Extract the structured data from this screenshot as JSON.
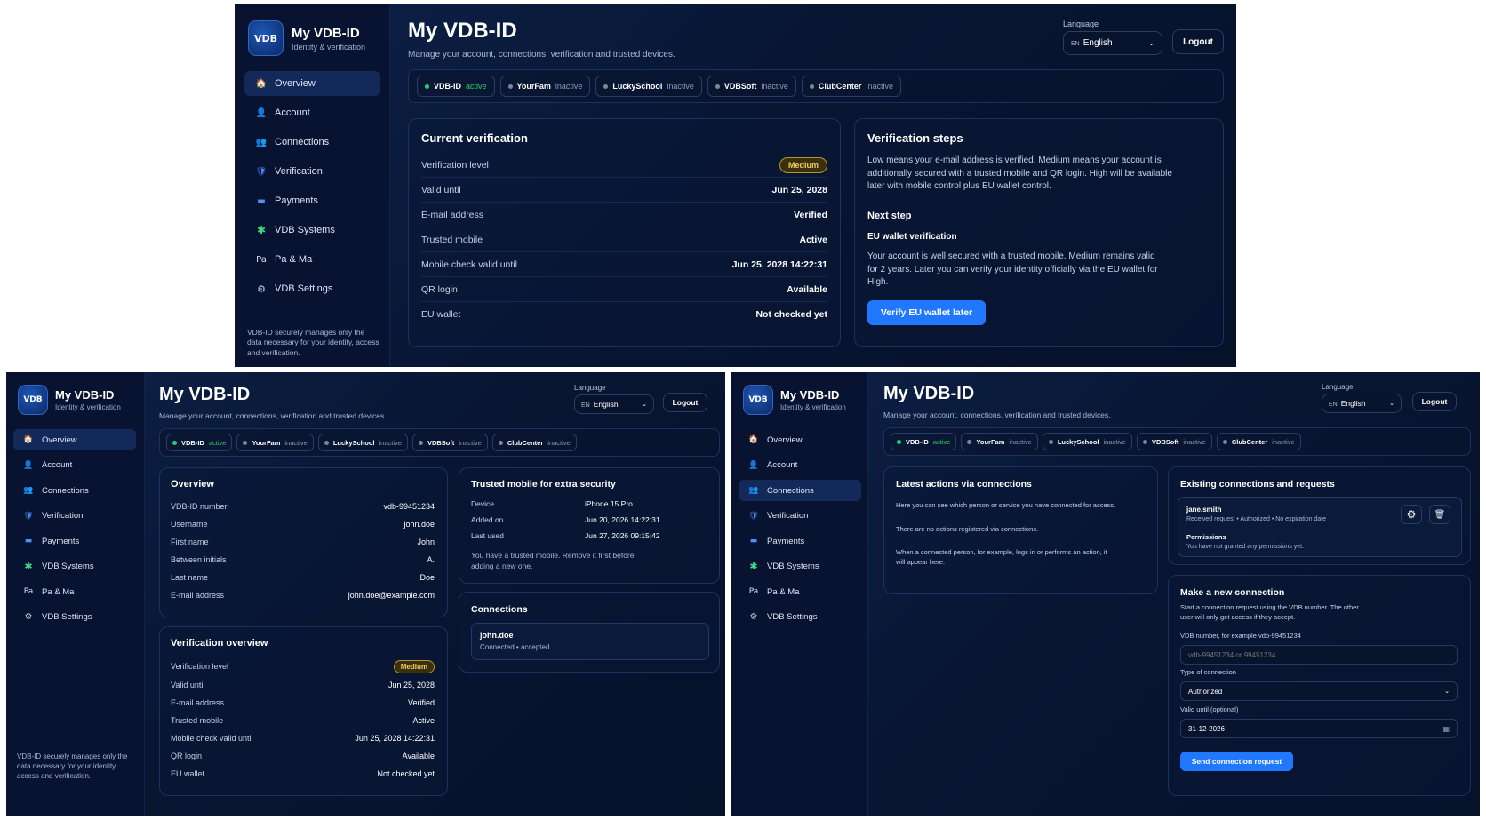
{
  "app": {
    "title": "My VDB-ID",
    "brand": "My VDB-ID",
    "brand_sub": "Identity & verification",
    "logo_text": "VDB",
    "subtitle": "Manage your account, connections, verification and trusted devices."
  },
  "lang": {
    "label": "Language",
    "code": "EN",
    "value": "English"
  },
  "logout_label": "Logout",
  "nav": [
    {
      "icon": "house-icon",
      "glyph": "🏠",
      "label": "Overview"
    },
    {
      "icon": "user-icon",
      "glyph": "👤",
      "label": "Account"
    },
    {
      "icon": "people-icon",
      "glyph": "👥",
      "label": "Connections"
    },
    {
      "icon": "shield-icon",
      "glyph": "🛡",
      "label": "Verification"
    },
    {
      "icon": "card-icon",
      "glyph": "▬",
      "label": "Payments"
    },
    {
      "icon": "puzzle-icon",
      "glyph": "✱",
      "label": "VDB Systems"
    },
    {
      "icon": "pa-icon",
      "glyph": "Pa",
      "label": "Pa & Ma"
    },
    {
      "icon": "gear-icon",
      "glyph": "⚙",
      "label": "VDB Settings"
    }
  ],
  "side_footer": "VDB-ID securely manages only the data necessary for your identity, access and verification.",
  "chips": [
    {
      "name": "VDB-ID",
      "status": "active"
    },
    {
      "name": "YourFam",
      "status": "inactive"
    },
    {
      "name": "LuckySchool",
      "status": "inactive"
    },
    {
      "name": "VDBSoft",
      "status": "inactive"
    },
    {
      "name": "ClubCenter",
      "status": "inactive"
    }
  ],
  "verification": {
    "title": "Current verification",
    "title_alt": "Verification overview",
    "rows": [
      {
        "k": "Verification level",
        "v": "Medium",
        "badge": true
      },
      {
        "k": "Valid until",
        "v": "Jun 25, 2028"
      },
      {
        "k": "E-mail address",
        "v": "Verified"
      },
      {
        "k": "Trusted mobile",
        "v": "Active"
      },
      {
        "k": "Mobile check valid until",
        "v": "Jun 25, 2028 14:22:31"
      },
      {
        "k": "QR login",
        "v": "Available"
      },
      {
        "k": "EU wallet",
        "v": "Not checked yet"
      }
    ]
  },
  "steps": {
    "title": "Verification steps",
    "intro": "Low means your e-mail address is verified. Medium means your account is additionally secured with a trusted mobile and QR login. High will be available later with mobile control plus EU wallet control.",
    "next_title": "Next step",
    "next_sub": "EU wallet verification",
    "next_text": "Your account is well secured with a trusted mobile. Medium remains valid for 2 years. Later you can verify your identity officially via the EU wallet for High.",
    "button": "Verify EU wallet later"
  },
  "overview": {
    "title": "Overview",
    "rows": [
      {
        "k": "VDB-ID number",
        "v": "vdb-99451234"
      },
      {
        "k": "Username",
        "v": "john.doe"
      },
      {
        "k": "First name",
        "v": "John"
      },
      {
        "k": "Between initials",
        "v": "A."
      },
      {
        "k": "Last name",
        "v": "Doe"
      },
      {
        "k": "E-mail address",
        "v": "john.doe@example.com"
      }
    ]
  },
  "trusted": {
    "title": "Trusted mobile for extra security",
    "rows": [
      {
        "k": "Device",
        "v": "iPhone 15 Pro"
      },
      {
        "k": "Added on",
        "v": "Jun 20, 2026 14:22:31"
      },
      {
        "k": "Last used",
        "v": "Jun 27, 2026 09:15:42"
      }
    ],
    "note": "You have a trusted mobile. Remove it first before adding a new one."
  },
  "connections_card": {
    "title": "Connections",
    "name": "john.doe",
    "meta": "Connected • accepted"
  },
  "latest": {
    "title": "Latest actions via connections",
    "p1": "Here you can see which person or service you have connected for access.",
    "p2": "There are no actions registered via connections.",
    "p3": "When a connected person, for example, logs in or performs an action, it will appear here."
  },
  "existing": {
    "title": "Existing connections and requests",
    "user": "jane.smith",
    "meta": "Received request • Authorized • No expiration date",
    "perm_title": "Permissions",
    "perm_text": "You have not granted any permissions yet."
  },
  "newconn": {
    "title": "Make a new connection",
    "intro": "Start a connection request using the VDB number. The other user will only get access if they accept.",
    "vdb_label": "VDB number, for example vdb-99451234",
    "vdb_placeholder": "vdb-99451234 or 99451234",
    "type_label": "Type of connection",
    "type_value": "Authorized",
    "valid_label": "Valid until (optional)",
    "valid_value": "31-12-2026",
    "button": "Send connection request"
  }
}
